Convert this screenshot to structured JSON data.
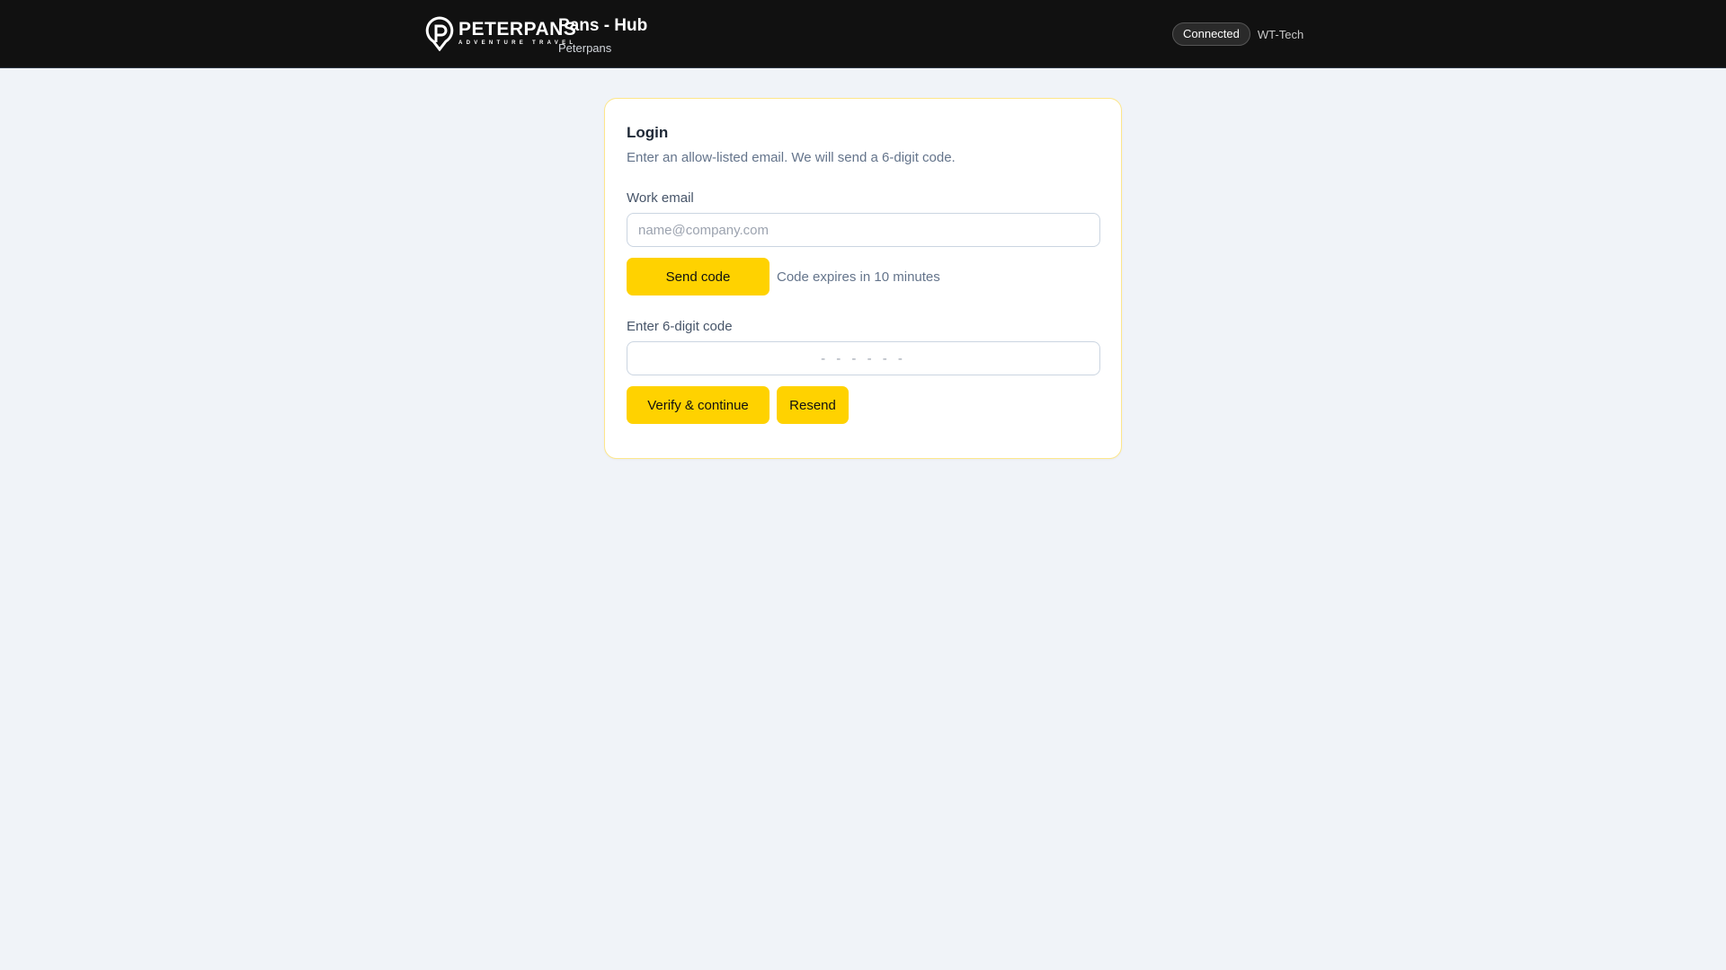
{
  "header": {
    "logo": {
      "name": "PETERPANS",
      "tagline": "ADVENTURE TRAVEL"
    },
    "app_title": "Pans - Hub",
    "app_subtitle": "Peterpans",
    "status_badge": "Connected",
    "org": "WT-Tech"
  },
  "login": {
    "title": "Login",
    "subtitle": "Enter an allow-listed email. We will send a 6-digit code.",
    "email_label": "Work email",
    "email_placeholder": "name@company.com",
    "email_value": "",
    "send_code": "Send code",
    "expires": "Code expires in 10 minutes",
    "code_label": "Enter 6-digit code",
    "code_placeholder": "- - - - - -",
    "verify": "Verify & continue",
    "resend": "Resend"
  },
  "colors": {
    "accent": "#ffd200",
    "header_bg": "#111111",
    "page_bg": "#f0f3f8"
  }
}
